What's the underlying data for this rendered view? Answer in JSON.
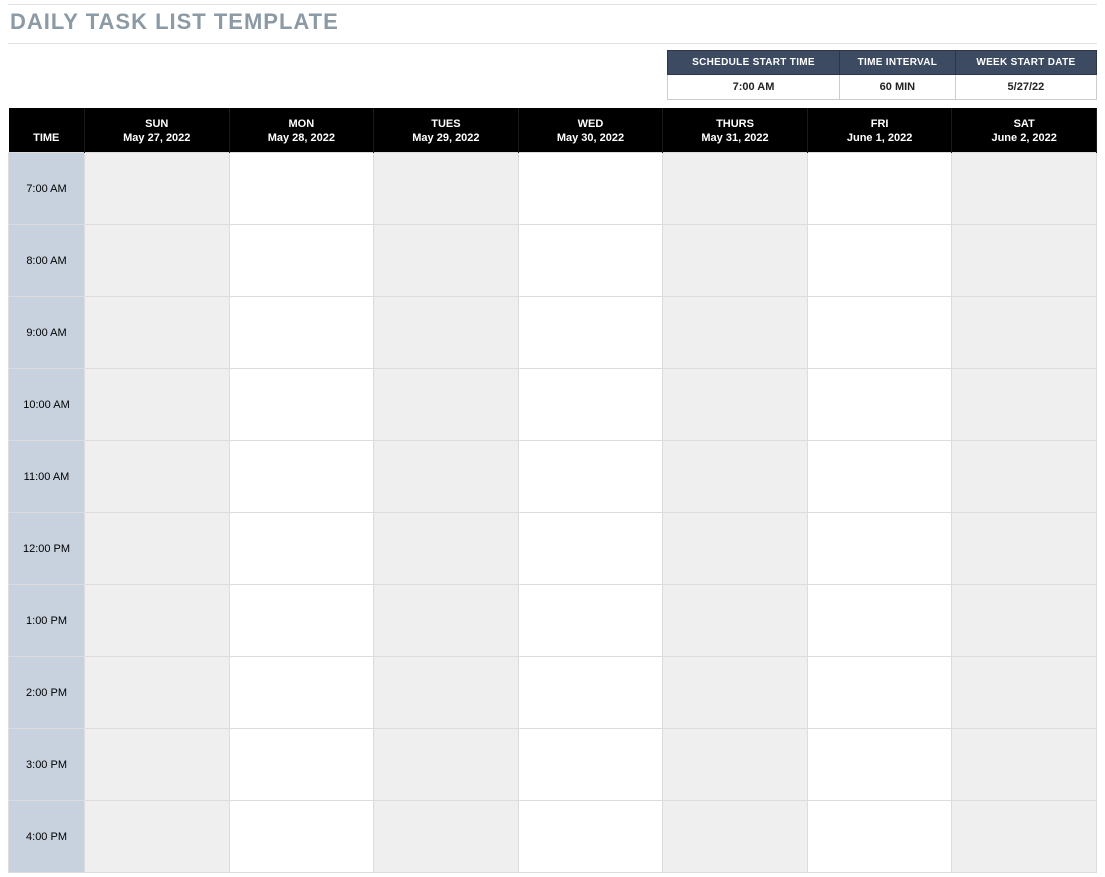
{
  "title": "DAILY TASK LIST TEMPLATE",
  "settings": {
    "headers": {
      "start_time": "SCHEDULE START TIME",
      "interval": "TIME INTERVAL",
      "week_start": "WEEK START DATE"
    },
    "values": {
      "start_time": "7:00 AM",
      "interval": "60 MIN",
      "week_start": "5/27/22"
    }
  },
  "columns": {
    "time_header": "TIME",
    "days": [
      {
        "name": "SUN",
        "date": "May 27, 2022"
      },
      {
        "name": "MON",
        "date": "May 28, 2022"
      },
      {
        "name": "TUES",
        "date": "May 29, 2022"
      },
      {
        "name": "WED",
        "date": "May 30, 2022"
      },
      {
        "name": "THURS",
        "date": "May 31, 2022"
      },
      {
        "name": "FRI",
        "date": "June 1, 2022"
      },
      {
        "name": "SAT",
        "date": "June 2, 2022"
      }
    ]
  },
  "time_slots": [
    "7:00 AM",
    "8:00 AM",
    "9:00 AM",
    "10:00 AM",
    "11:00 AM",
    "12:00 PM",
    "1:00 PM",
    "2:00 PM",
    "3:00 PM",
    "4:00 PM"
  ]
}
